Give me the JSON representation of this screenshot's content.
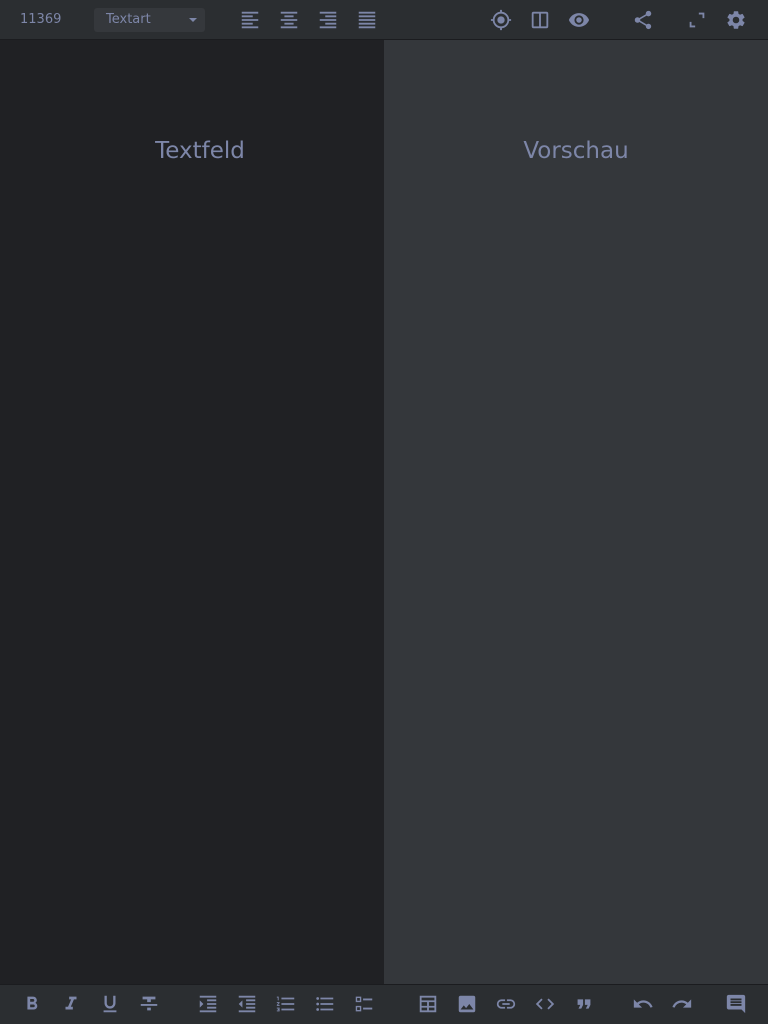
{
  "toolbar": {
    "counter": "11369",
    "text_style": {
      "selected": "Textart"
    },
    "align_icons": [
      "align-left-icon",
      "align-center-icon",
      "align-right-icon",
      "align-justify-icon"
    ],
    "right_icons": [
      "target-icon",
      "split-view-icon",
      "eye-icon",
      "share-icon",
      "fullscreen-icon",
      "settings-icon"
    ]
  },
  "panes": {
    "editor_label": "Textfeld",
    "preview_label": "Vorschau"
  },
  "format_bar": {
    "icons": [
      "bold-icon",
      "italic-icon",
      "underline-icon",
      "strikethrough-icon",
      "indent-increase-icon",
      "indent-decrease-icon",
      "ordered-list-icon",
      "bullet-list-icon",
      "checklist-icon",
      "table-icon",
      "image-icon",
      "link-icon",
      "code-icon",
      "quote-icon",
      "undo-icon",
      "redo-icon",
      "comment-icon"
    ]
  },
  "colors": {
    "bar_bg": "#2b2e31",
    "editor_bg": "#202124",
    "preview_bg": "#34373b",
    "icon": "#7d86a8"
  }
}
